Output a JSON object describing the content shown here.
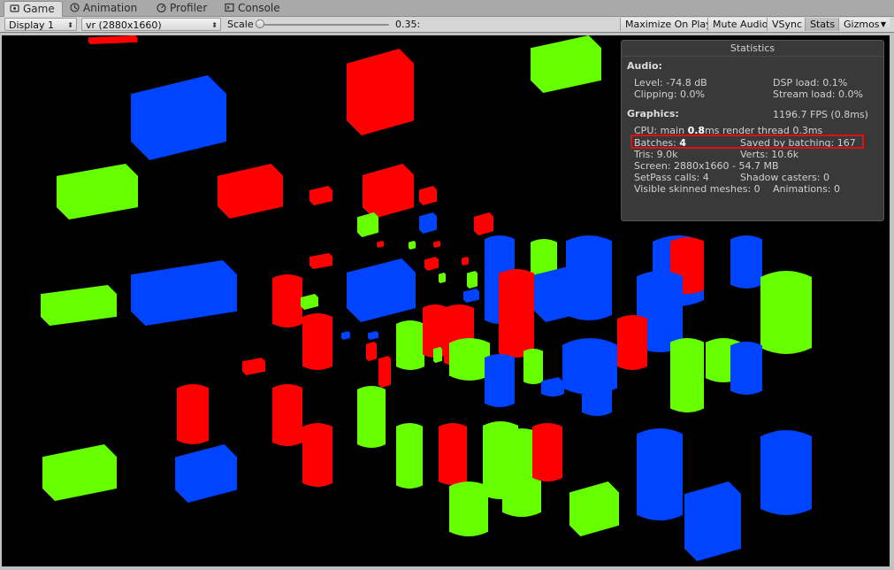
{
  "tabs": [
    {
      "label": "Game",
      "icon": "game-icon",
      "active": true
    },
    {
      "label": "Animation",
      "icon": "animation-icon",
      "active": false
    },
    {
      "label": "Profiler",
      "icon": "profiler-icon",
      "active": false
    },
    {
      "label": "Console",
      "icon": "console-icon",
      "active": false
    }
  ],
  "toolbar": {
    "display": "Display 1",
    "resolution": "vr (2880x1660)",
    "scale_label": "Scale",
    "scale_value": "0.35:",
    "scale_fraction": 0.01,
    "maximize": "Maximize On Play",
    "mute": "Mute Audio",
    "vsync": "VSync",
    "stats": "Stats",
    "gizmos": "Gizmos"
  },
  "stats": {
    "title": "Statistics",
    "audio_header": "Audio:",
    "level": "Level: -74.8 dB",
    "dsp": "DSP load: 0.1%",
    "clipping": "Clipping: 0.0%",
    "stream": "Stream load: 0.0%",
    "graphics_header": "Graphics:",
    "fps": "1196.7 FPS (0.8ms)",
    "cpu_prefix": "CPU: main ",
    "cpu_main": "0.8",
    "cpu_suffix": "ms  render thread 0.3ms",
    "batches_label": "Batches: ",
    "batches_value": "4",
    "saved": "Saved by batching: 167",
    "tris": "Tris: 9.0k",
    "verts": "Verts: 10.6k",
    "screen": "Screen: 2880x1660 - 54.7 MB",
    "setpass": "SetPass calls: 4",
    "shadow": "Shadow casters: 0",
    "skinned": "Visible skinned meshes: 0",
    "animations": "Animations: 0"
  },
  "colors": {
    "red": "#ff0000",
    "green": "#66ff00",
    "blue": "#0044ff",
    "highlight": "#e01010"
  }
}
